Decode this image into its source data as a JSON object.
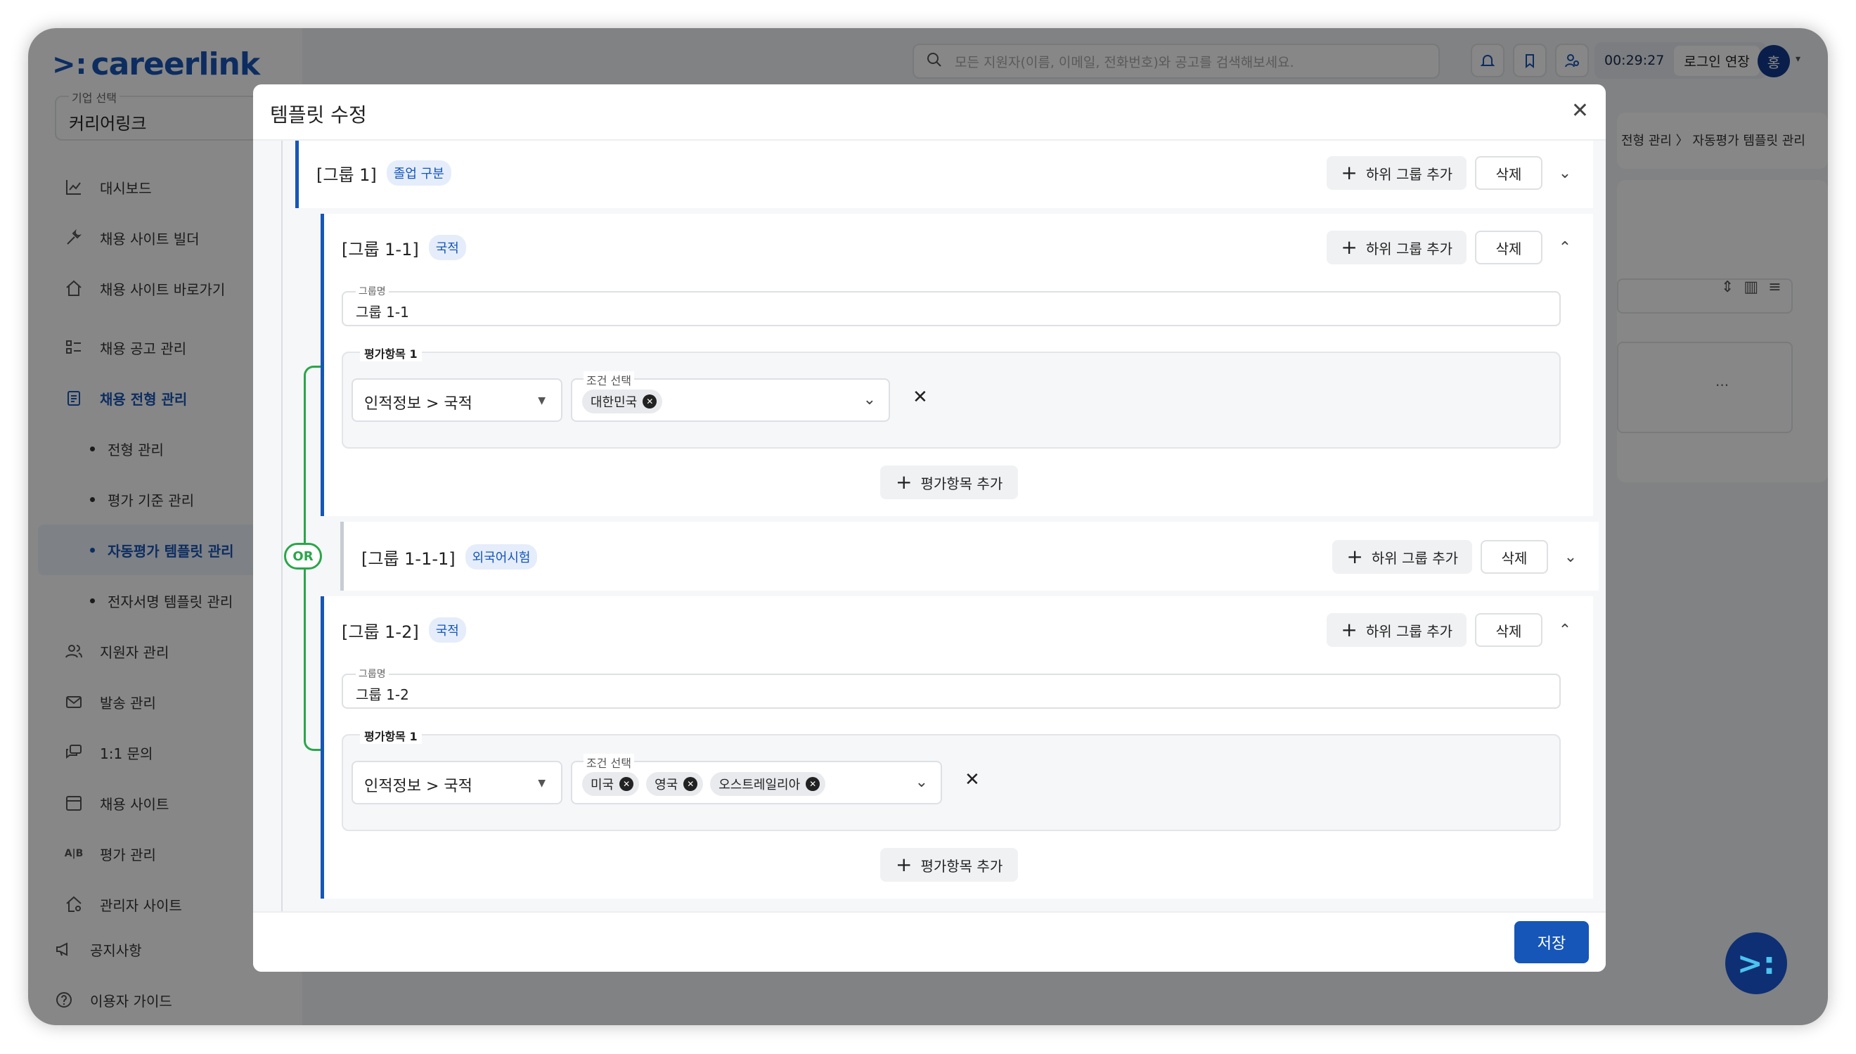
{
  "app": {
    "logo_mark": ">:",
    "logo_text": "careerlink",
    "company_label": "기업 선택",
    "company_value": "커리어링크"
  },
  "nav": {
    "items": [
      {
        "label": "대시보드",
        "icon": "chart-icon"
      },
      {
        "label": "채용 사이트 빌더",
        "icon": "tools-icon"
      },
      {
        "label": "채용 사이트 바로가기",
        "icon": "home-icon"
      },
      {
        "label": "채용 공고 관리",
        "icon": "list-icon"
      },
      {
        "label": "채용 전형 관리",
        "icon": "clipboard-icon"
      }
    ],
    "sub_items": [
      "전형 관리",
      "평가 기준 관리",
      "자동평가 템플릿 관리",
      "전자서명 템플릿 관리"
    ],
    "items2": [
      {
        "label": "지원자 관리",
        "icon": "users-icon"
      },
      {
        "label": "발송 관리",
        "icon": "mail-icon"
      },
      {
        "label": "1:1 문의",
        "icon": "chat-icon"
      },
      {
        "label": "채용 사이트",
        "icon": "calendar-icon"
      },
      {
        "label": "평가 관리",
        "icon": "ab-icon"
      },
      {
        "label": "관리자 사이트",
        "icon": "admin-home-icon"
      }
    ],
    "bottom": [
      {
        "label": "공지사항",
        "icon": "megaphone-icon"
      },
      {
        "label": "이용자 가이드",
        "icon": "help-icon"
      }
    ],
    "ab_glyph": "A|B"
  },
  "topbar": {
    "search_placeholder": "모든 지원자(이름, 이메일, 전화번호)와 공고를 검색해보세요.",
    "timer": "00:29:27",
    "extend_label": "로그인 연장",
    "avatar_initial": "홍"
  },
  "background": {
    "breadcrumb": "전형 관리 〉 자동평가 템플릿 관리",
    "dots": "..."
  },
  "modal": {
    "title": "템플릿 수정",
    "save_label": "저장",
    "add_sub_label": "하위 그룹 추가",
    "delete_label": "삭제",
    "add_item_label": "평가항목 추가",
    "group_name_label": "그룹명",
    "item_label": "평가항목 1",
    "condition_label": "조건 선택",
    "or_label": "OR",
    "groups": [
      {
        "title": "[그룹 1]",
        "tag": "졸업 구분"
      },
      {
        "title": "[그룹 1-1]",
        "tag": "국적",
        "name": "그룹 1-1",
        "category": "인적정보 > 국적",
        "chips": [
          "대한민국"
        ]
      },
      {
        "title": "[그룹 1-1-1]",
        "tag": "외국어시험"
      },
      {
        "title": "[그룹 1-2]",
        "tag": "국적",
        "name": "그룹 1-2",
        "category": "인적정보 > 국적",
        "chips": [
          "미국",
          "영국",
          "오스트레일리아"
        ]
      }
    ]
  },
  "colors": {
    "primary": "#1556b8",
    "or_green": "#2aa64a",
    "overlay": "rgba(0,0,0,0.47)"
  }
}
